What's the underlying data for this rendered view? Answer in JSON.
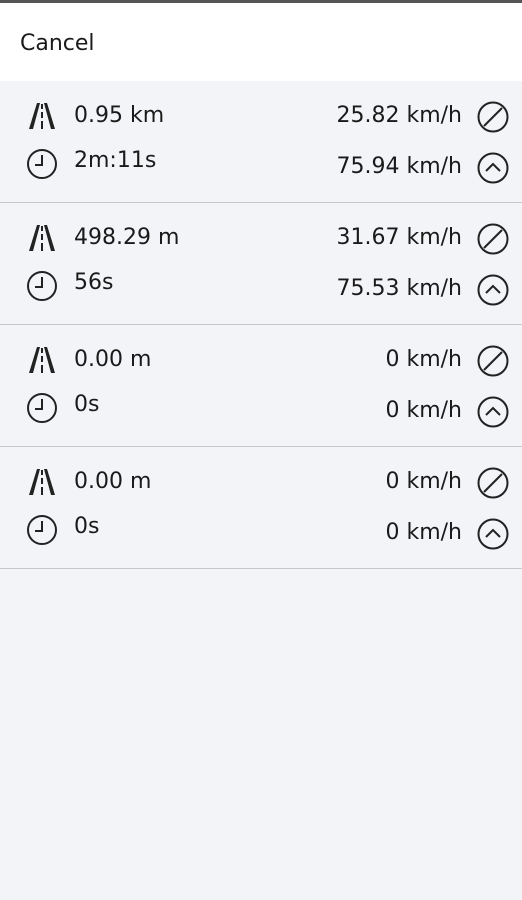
{
  "header": {
    "cancel_label": "Cancel"
  },
  "icons": {
    "distance": "road-icon",
    "time": "clock-icon",
    "average_speed": "average-speed-icon",
    "max_speed": "max-speed-icon"
  },
  "stats": [
    {
      "distance": "0.95 km",
      "time": "2m:11s",
      "avg_speed": "25.82 km/h",
      "max_speed": "75.94 km/h"
    },
    {
      "distance": "498.29 m",
      "time": "56s",
      "avg_speed": "31.67 km/h",
      "max_speed": "75.53 km/h"
    },
    {
      "distance": "0.00 m",
      "time": "0s",
      "avg_speed": "0 km/h",
      "max_speed": "0 km/h"
    },
    {
      "distance": "0.00 m",
      "time": "0s",
      "avg_speed": "0 km/h",
      "max_speed": "0 km/h"
    }
  ]
}
